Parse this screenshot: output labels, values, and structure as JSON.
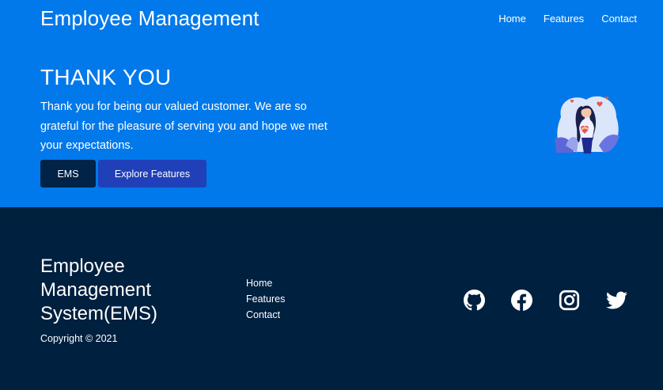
{
  "header": {
    "brand": "Employee Management",
    "nav": [
      "Home",
      "Features",
      "Contact"
    ]
  },
  "hero": {
    "headline": "THANK YOU",
    "message": "Thank you for being our valued customer. We are so grateful for the pleasure of serving you and hope we met your expectations.",
    "buttons": {
      "primary": "EMS",
      "secondary": "Explore Features"
    },
    "illustration_icon": "woman-hugging-heart-illustration"
  },
  "footer": {
    "title": "Employee Management System(EMS)",
    "copyright": "Copyright © 2021",
    "links": [
      "Home",
      "Features",
      "Contact"
    ],
    "social_icons": [
      "github-icon",
      "facebook-icon",
      "instagram-icon",
      "twitter-icon"
    ]
  },
  "colors": {
    "hero_bg": "#0279ea",
    "footer_bg": "#00203f",
    "btn_dark": "#002347",
    "btn_blue": "#1f40b8"
  }
}
